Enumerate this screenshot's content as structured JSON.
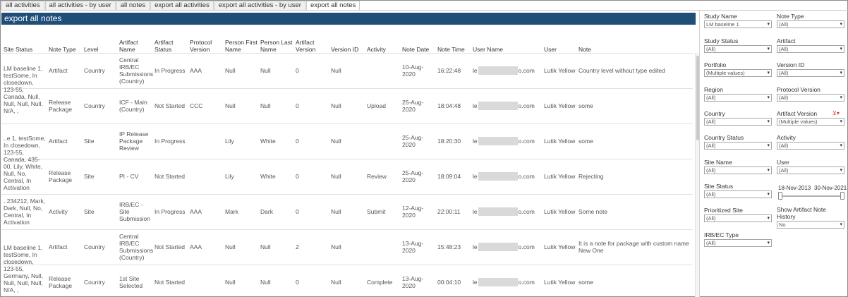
{
  "tabs": [
    "all activities",
    "all activities - by user",
    "all notes",
    "export all activities",
    "export all activities - by user",
    "export all notes"
  ],
  "title": "export all notes",
  "columns": {
    "site_status": "Site Status",
    "note_type": "Note Type",
    "level": "Level",
    "artifact_name": "Artifact Name",
    "artifact_status": "Artifact Status",
    "protocol_version": "Protocol Version",
    "person_first": "Person First Name",
    "person_last": "Person Last Name",
    "artifact_version": "Artifact Version",
    "version_id": "Version ID",
    "activity": "Activity",
    "note_date": "Note Date",
    "note_time": "Note Time",
    "user_name": "User Name",
    "user": "User",
    "note": "Note"
  },
  "site_groups": [
    "LM baseline 1, testSome, In closedown, 123-55, Canada, Null, Null, Null, Null, N/A, ,",
    "..e 1, testSome, In closedown, 123-55, Canada, 435-00, Lily, White, Null, No, Central, In Activation",
    "..234212, Mark, Dark, Null, No, Central, In Activation",
    "LM baseline 1, testSome, In closedown, 123-55, Germany, Null, Null, Null, Null, N/A, ,"
  ],
  "rows": [
    {
      "note_type": "Artifact",
      "level": "Country",
      "artifact_name": "Central IRB/EC Submissions (Country)",
      "artifact_status": "In Progress",
      "protocol_version": "AAA",
      "person_first": "Null",
      "person_last": "Null",
      "artifact_version": "0",
      "version_id": "Null",
      "activity": "",
      "note_date": "10-Aug-2020",
      "note_time": "16:22:48",
      "user_name_a": "le",
      "user_name_b": "o.com",
      "user": "Lutik Yellow",
      "note": "Country level without type edited"
    },
    {
      "note_type": "Release Package",
      "level": "Country",
      "artifact_name": "ICF - Main (Country)",
      "artifact_status": "Not Started",
      "protocol_version": "CCC",
      "person_first": "Null",
      "person_last": "Null",
      "artifact_version": "0",
      "version_id": "Null",
      "activity": "Upload",
      "note_date": "25-Aug-2020",
      "note_time": "18:04:48",
      "user_name_a": "le",
      "user_name_b": "o.com",
      "user": "Lutik Yellow",
      "note": "some"
    },
    {
      "note_type": "Artifact",
      "level": "Site",
      "artifact_name": "IP Release Package Review",
      "artifact_status": "In Progress",
      "protocol_version": "",
      "person_first": "Lily",
      "person_last": "White",
      "artifact_version": "0",
      "version_id": "Null",
      "activity": "",
      "note_date": "25-Aug-2020",
      "note_time": "18:20:30",
      "user_name_a": "le",
      "user_name_b": "o.com",
      "user": "Lutik Yellow",
      "note": "some"
    },
    {
      "note_type": "Release Package",
      "level": "Site",
      "artifact_name": "PI - CV",
      "artifact_status": "Not Started",
      "protocol_version": "",
      "person_first": "Lily",
      "person_last": "White",
      "artifact_version": "0",
      "version_id": "Null",
      "activity": "Review",
      "note_date": "25-Aug-2020",
      "note_time": "18:09:04",
      "user_name_a": "le",
      "user_name_b": "o.com",
      "user": "Lutik Yellow",
      "note": "Rejecting"
    },
    {
      "note_type": "Activity",
      "level": "Site",
      "artifact_name": "IRB/EC - Site Submission",
      "artifact_status": "In Progress",
      "protocol_version": "AAA",
      "person_first": "Mark",
      "person_last": "Dark",
      "artifact_version": "0",
      "version_id": "Null",
      "activity": "Submit",
      "note_date": "12-Aug-2020",
      "note_time": "22:00:11",
      "user_name_a": "le",
      "user_name_b": "o.com",
      "user": "Lutik Yellow",
      "note": "Some note"
    },
    {
      "note_type": "Artifact",
      "level": "Country",
      "artifact_name": "Central IRB/EC Submissions (Country)",
      "artifact_status": "Not Started",
      "protocol_version": "AAA",
      "person_first": "Null",
      "person_last": "Null",
      "artifact_version": "2",
      "version_id": "Null",
      "activity": "",
      "note_date": "13-Aug-2020",
      "note_time": "15:48:23",
      "user_name_a": "le",
      "user_name_b": "o.com",
      "user": "Lutik Yellow",
      "note": "It is a note for package with custom name New One"
    },
    {
      "note_type": "Release Package",
      "level": "Country",
      "artifact_name": "1st Site Selected",
      "artifact_status": "Not Started",
      "protocol_version": "",
      "person_first": "Null",
      "person_last": "Null",
      "artifact_version": "0",
      "version_id": "Null",
      "activity": "Complete",
      "note_date": "13-Aug-2020",
      "note_time": "00:04:10",
      "user_name_a": "le",
      "user_name_b": "o.com",
      "user": "Lutik Yellow",
      "note": "some"
    }
  ],
  "filters": [
    {
      "label": "Study Name",
      "value": "LM baseline 1"
    },
    {
      "label": "Note Type",
      "value": "(All)"
    },
    {
      "label": "Study Status",
      "value": "(All)"
    },
    {
      "label": "Artifact",
      "value": "(All)"
    },
    {
      "label": "Portfolio",
      "value": "(Multiple values)"
    },
    {
      "label": "Version ID",
      "value": "(All)"
    },
    {
      "label": "Region",
      "value": "(All)"
    },
    {
      "label": "Protocol Version",
      "value": "(All)"
    },
    {
      "label": "Country",
      "value": "(All)"
    },
    {
      "label": "Artifact Version",
      "value": "(Multiple values)"
    },
    {
      "label": "Country Status",
      "value": "(All)"
    },
    {
      "label": "Activity",
      "value": "(All)"
    },
    {
      "label": "Site Name",
      "value": "(All)"
    },
    {
      "label": "User",
      "value": "(All)"
    },
    {
      "label": "Site Status",
      "value": "(All)"
    },
    {
      "label": "Prioritized Site",
      "value": "(All)"
    },
    {
      "label": "IRB/EC Type",
      "value": "(All)"
    }
  ],
  "date_range": {
    "start": "18-Nov-2013",
    "end": "30-Nov-2021",
    "start_fraction": 0.0,
    "end_fraction": 1.0
  },
  "show_history": {
    "label": "Show Artifact Note History",
    "value": "No"
  },
  "colors": {
    "banner": "#1f4e79",
    "banner_text": "#ffffff",
    "filter_active": "#d04040"
  }
}
